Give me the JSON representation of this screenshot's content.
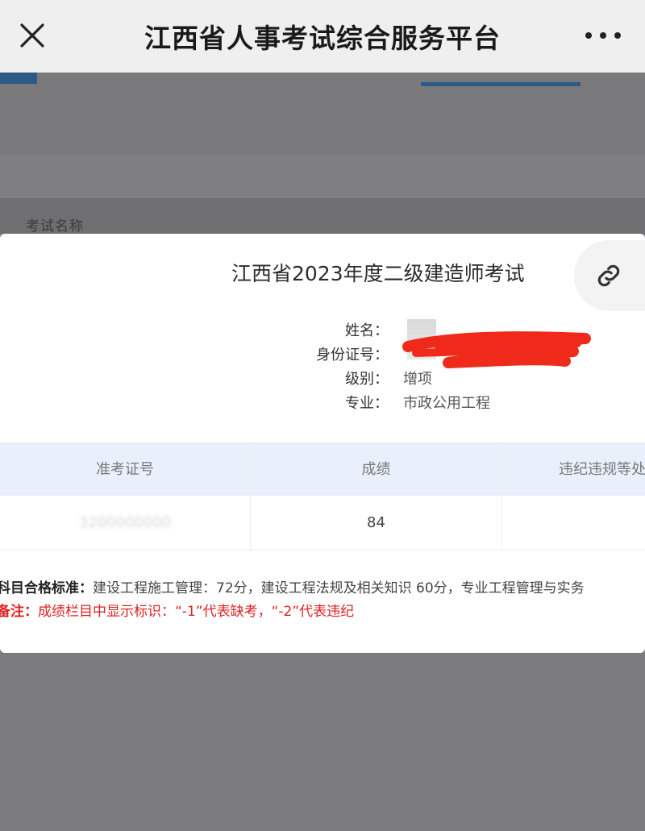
{
  "navbar": {
    "title": "江西省人事考试综合服务平台",
    "close_icon": "close-icon",
    "more_icon": "more-dots-icon"
  },
  "background": {
    "exam_name_label": "考试名称"
  },
  "card": {
    "title": "江西省2023年度二级建造师考试",
    "link_icon": "link-icon",
    "info": {
      "name_label": "姓名：",
      "id_label": "身份证号：",
      "level_label": "级别：",
      "level_value": "增项",
      "major_label": "专业：",
      "major_value": "市政公用工程"
    },
    "table": {
      "headers": [
        "准考证号",
        "成绩",
        "违纪违规等处"
      ],
      "rows": [
        {
          "ticket": "3200000000",
          "score": "84",
          "violation": ""
        }
      ]
    },
    "notes": {
      "standard_label": "科目合格标准：",
      "standard_text": "建设工程施工管理：72分，建设工程法规及相关知识 60分，专业工程管理与实务",
      "remark_label": "备注：",
      "remark_text": "成绩栏目中显示标识：“-1”代表缺考，“-2”代表违纪"
    }
  },
  "colors": {
    "overlay": "#7c7c7e",
    "navbar_bg": "#efefef",
    "table_header_bg": "#e9f0fb",
    "accent_blue": "#2c5a86",
    "remark_red": "#e02020",
    "redaction_red": "#f02a1a"
  }
}
